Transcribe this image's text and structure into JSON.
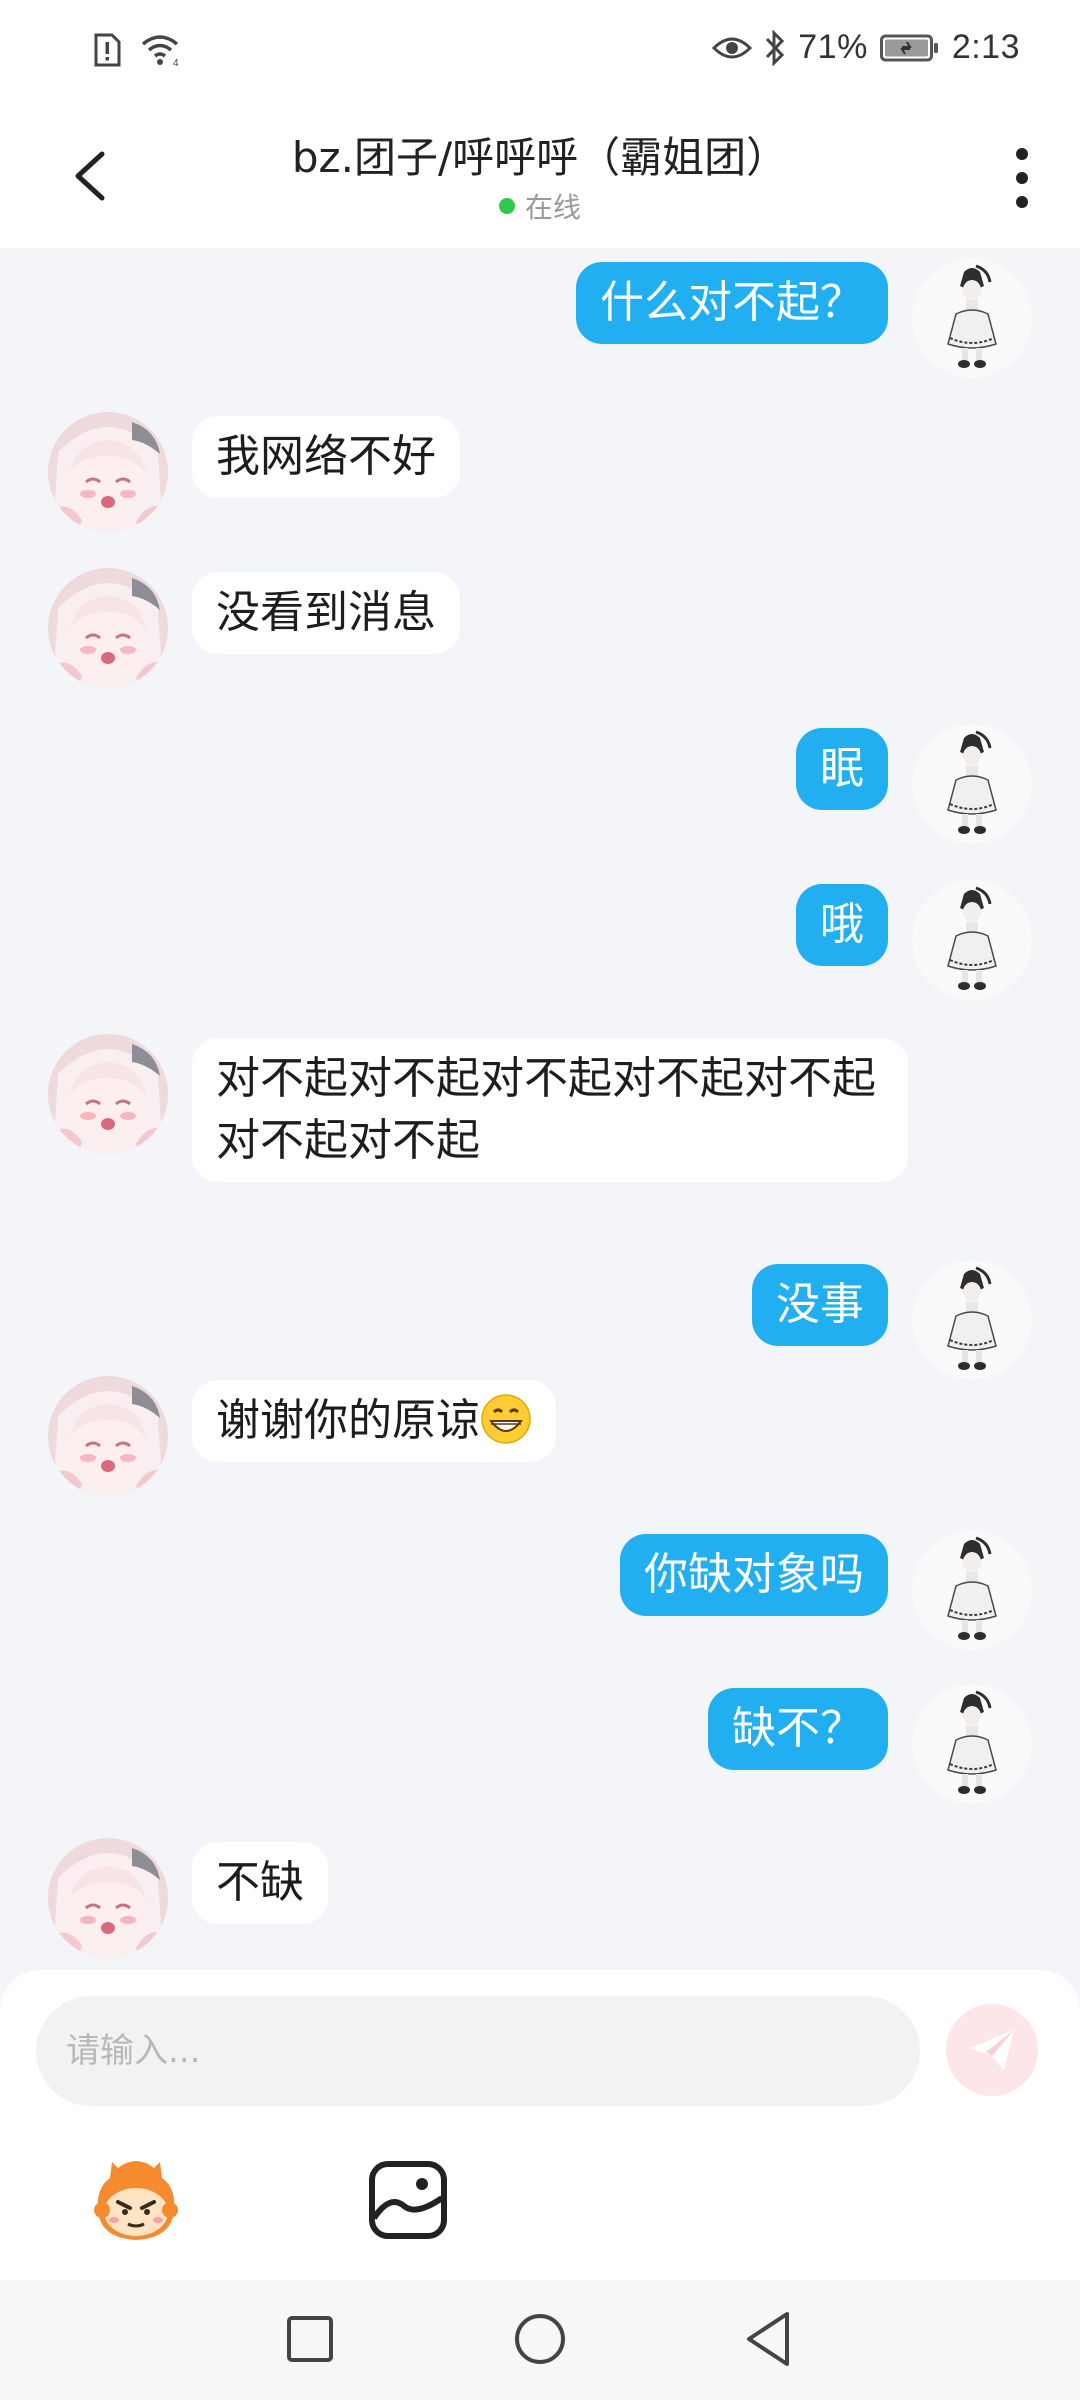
{
  "status_bar": {
    "left_icons": [
      "alert-sim-icon",
      "wifi-icon"
    ],
    "right_icons": [
      "eye-icon",
      "bluetooth-icon",
      "battery-icon"
    ],
    "battery": "71%",
    "time": "2:13"
  },
  "header": {
    "title": "bz.团子/呼呼呼（霸姐团）",
    "status": "在线",
    "status_color": "#2DC84D"
  },
  "messages": [
    {
      "side": "out",
      "text": "什么对不起？"
    },
    {
      "side": "in",
      "text": "我网络不好"
    },
    {
      "side": "in",
      "text": "没看到消息"
    },
    {
      "side": "out",
      "text": "眠"
    },
    {
      "side": "out",
      "text": "哦"
    },
    {
      "side": "in",
      "text": "对不起对不起对不起对不起对不起对不起对不起"
    },
    {
      "side": "out",
      "text": "没事"
    },
    {
      "side": "in",
      "text": "谢谢你的原谅",
      "emoji": "grinning-face-emoji"
    },
    {
      "side": "out",
      "text": "你缺对象吗"
    },
    {
      "side": "out",
      "text": "缺不？"
    },
    {
      "side": "in",
      "text": "不缺"
    }
  ],
  "input": {
    "placeholder": "请输入..."
  },
  "colors": {
    "outgoing_bubble": "#21AFF2",
    "incoming_bubble": "#FFFFFF",
    "background": "#F3F5F8",
    "send_button": "#FCE6E8"
  },
  "nav_icons": [
    "recent-apps-icon",
    "home-icon",
    "back-nav-icon"
  ]
}
